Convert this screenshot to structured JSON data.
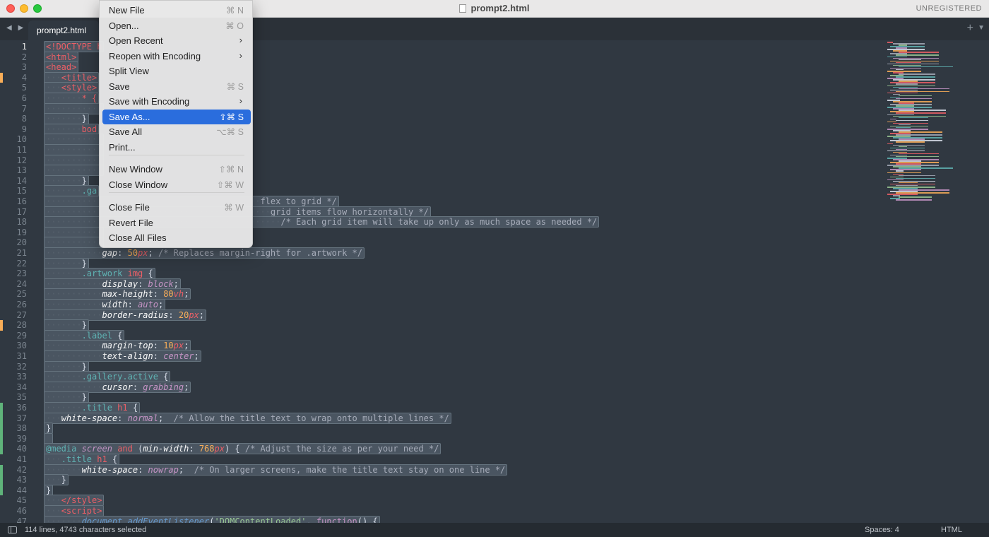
{
  "window": {
    "title": "prompt2.html",
    "license_status": "UNREGISTERED"
  },
  "tabs": {
    "nav_arrows": "◀ ▶",
    "active_tab": "prompt2.html",
    "new_tab_icon": "+",
    "tab_menu_icon": "▼"
  },
  "file_menu": {
    "items": [
      {
        "label": "New File",
        "shortcut": "⌘ N"
      },
      {
        "label": "Open...",
        "shortcut": "⌘ O"
      },
      {
        "label": "Open Recent",
        "submenu": true
      },
      {
        "label": "Reopen with Encoding",
        "submenu": true
      },
      {
        "label": "Split View",
        "shortcut": ""
      },
      {
        "label": "Save",
        "shortcut": "⌘ S"
      },
      {
        "label": "Save with Encoding",
        "submenu": true
      },
      {
        "label": "Save As...",
        "shortcut": "⇧⌘ S",
        "highlighted": true
      },
      {
        "label": "Save All",
        "shortcut": "⌥⌘ S"
      },
      {
        "label": "Print...",
        "shortcut": ""
      },
      {
        "label": "New Window",
        "shortcut": "⇧⌘ N"
      },
      {
        "label": "Close Window",
        "shortcut": "⇧⌘ W"
      },
      {
        "label": "Close File",
        "shortcut": "⌘ W"
      },
      {
        "label": "Revert File",
        "shortcut": ""
      },
      {
        "label": "Close All Files",
        "shortcut": ""
      }
    ]
  },
  "editor": {
    "line_numbers": [
      "1",
      "2",
      "3",
      "4",
      "5",
      "6",
      "7",
      "8",
      "9",
      "10",
      "11",
      "12",
      "13",
      "14",
      "15",
      "16",
      "17",
      "18",
      "19",
      "20",
      "21",
      "22",
      "23",
      "24",
      "25",
      "26",
      "27",
      "28",
      "29",
      "30",
      "31",
      "32",
      "33",
      "34",
      "35",
      "36",
      "37",
      "38",
      "39",
      "40",
      "41",
      "42",
      "43",
      "44",
      "45",
      "46",
      "47"
    ],
    "visible_fragments": {
      "l1": "<!DOCTYPE h",
      "l2": "<html>",
      "l3": "<head>",
      "l4": "<title>",
      "l5": "<style>",
      "l6": "* {",
      "l8": "}",
      "l9": "bod",
      "l14": "}",
      "l15": ".ga",
      "l16": "flex to grid */",
      "l17": "grid items flow horizontally */",
      "l18": "/* Each grid item will take up only as much space as needed */",
      "l21_prop": "gap",
      "l21_num": "50",
      "l21_unit": "px",
      "l21_comment": "/* Replaces margin-right for .artwork */",
      "l22": "}",
      "l23_sel": ".artwork",
      "l23_tag": "img",
      "l24_prop": "display",
      "l24_val": "block",
      "l25_prop": "max-height",
      "l25_num": "80",
      "l25_unit": "vh",
      "l26_prop": "width",
      "l26_val": "auto",
      "l27_prop": "border-radius",
      "l27_num": "20",
      "l27_unit": "px",
      "l28": "}",
      "l29_sel": ".label",
      "l30_prop": "margin-top",
      "l30_num": "10",
      "l30_unit": "px",
      "l31_prop": "text-align",
      "l31_val": "center",
      "l32": "}",
      "l33_sel1": ".gallery",
      "l33_sel2": ".active",
      "l34_prop": "cursor",
      "l34_val": "grabbing",
      "l35": "}",
      "l36_sel": ".title",
      "l36_tag": "h1",
      "l37_prop": "white-space",
      "l37_val": "normal",
      "l37_comment": "/* Allow the title text to wrap onto multiple lines */",
      "l38": "}",
      "l40_at": "@media",
      "l40_kw1": "screen",
      "l40_kw2": "and",
      "l40_prop": "min-width",
      "l40_num": "768",
      "l40_unit": "px",
      "l40_comment": "/* Adjust the size as per your need */",
      "l41_sel": ".title",
      "l41_tag": "h1",
      "l42_prop": "white-space",
      "l42_val": "nowrap",
      "l42_comment": "/* On larger screens, make the title text stay on one line */",
      "l43": "}",
      "l44": "}",
      "l45": "</style>",
      "l46": "<script>",
      "l47_obj": "document",
      "l47_fn": "addEventListener",
      "l47_str": "'DOMContentLoaded'",
      "l47_kw": "function",
      "l47_tail": "() {"
    }
  },
  "statusbar": {
    "selection": "114 lines, 4743 characters selected",
    "indentation": "Spaces: 4",
    "syntax": "HTML"
  },
  "colors": {
    "editor_bg": "#303841",
    "menu_highlight": "#2a6ddd",
    "tag": "#ec5f66",
    "number": "#f9ae58",
    "selector": "#5fb4b4"
  }
}
